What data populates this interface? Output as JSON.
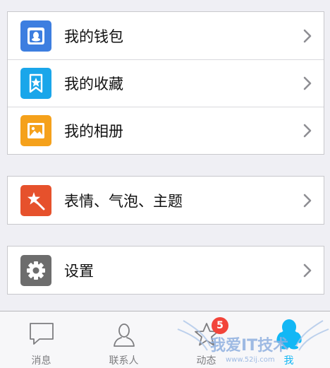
{
  "menu": {
    "group1": [
      {
        "label": "我的钱包",
        "icon": "wallet-icon",
        "color": "#3d7ee0"
      },
      {
        "label": "我的收藏",
        "icon": "favorites-icon",
        "color": "#1aa6ea"
      },
      {
        "label": "我的相册",
        "icon": "album-icon",
        "color": "#f5a11b"
      }
    ],
    "group2": [
      {
        "label": "表情、气泡、主题",
        "icon": "emoji-theme-icon",
        "color": "#e6512c"
      }
    ],
    "group3": [
      {
        "label": "设置",
        "icon": "settings-gear-icon",
        "color": "#6d6d6d"
      }
    ]
  },
  "tabbar": {
    "tabs": [
      {
        "label": "消息",
        "icon": "chat-bubble-icon"
      },
      {
        "label": "联系人",
        "icon": "contacts-person-icon"
      },
      {
        "label": "动态",
        "icon": "star-icon",
        "badge": "5"
      },
      {
        "label": "我",
        "icon": "me-penguin-icon",
        "active": true
      }
    ],
    "active_color": "#12b7f5",
    "badge_color": "#f2443a"
  },
  "watermark": {
    "text": "我爱IT技术",
    "url": "www.52ij.com"
  }
}
